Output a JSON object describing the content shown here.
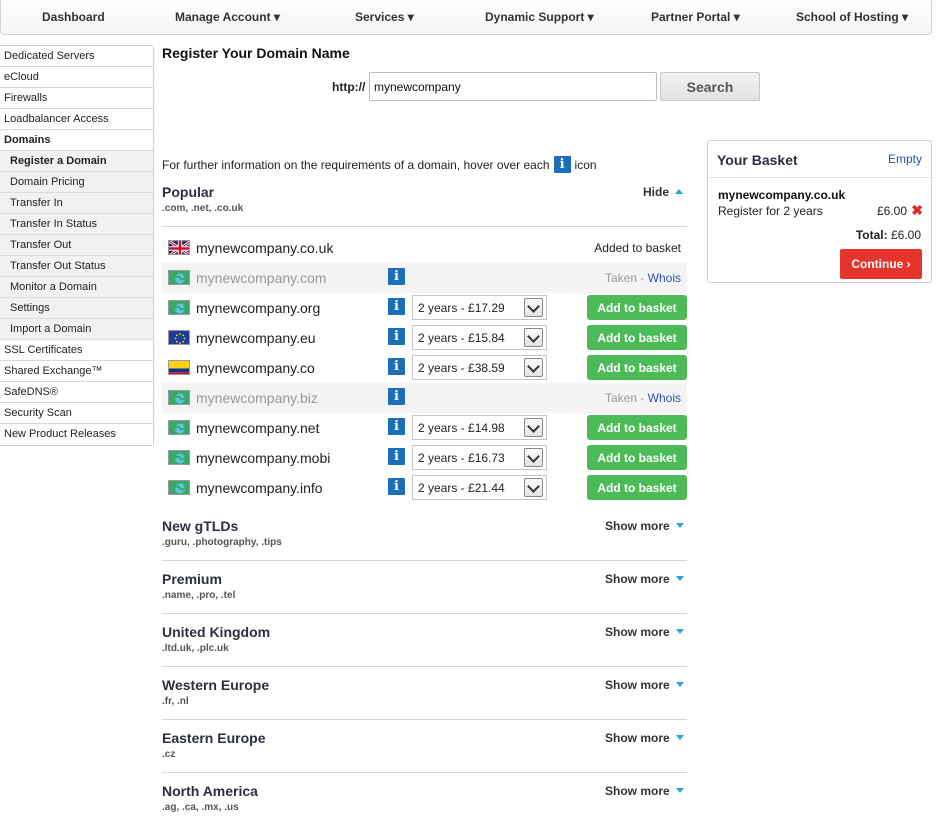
{
  "nav": {
    "items": [
      {
        "label": "Dashboard"
      },
      {
        "label": "Manage Account ▾"
      },
      {
        "label": "Services ▾"
      },
      {
        "label": "Dynamic Support ▾"
      },
      {
        "label": "Partner Portal ▾"
      },
      {
        "label": "School of Hosting ▾"
      }
    ]
  },
  "sidebar": {
    "items": [
      {
        "label": "Dedicated Servers"
      },
      {
        "label": "eCloud"
      },
      {
        "label": "Firewalls"
      },
      {
        "label": "Loadbalancer Access"
      },
      {
        "label": "Domains"
      },
      {
        "label": "Register a Domain"
      },
      {
        "label": "Domain Pricing"
      },
      {
        "label": "Transfer In"
      },
      {
        "label": "Transfer In Status"
      },
      {
        "label": "Transfer Out"
      },
      {
        "label": "Transfer Out Status"
      },
      {
        "label": "Monitor a Domain"
      },
      {
        "label": "Settings"
      },
      {
        "label": "Import a Domain"
      },
      {
        "label": "SSL Certificates"
      },
      {
        "label": "Shared Exchange™"
      },
      {
        "label": "SafeDNS®"
      },
      {
        "label": "Security Scan"
      },
      {
        "label": "New Product Releases"
      }
    ]
  },
  "main": {
    "title": "Register Your Domain Name",
    "http_label": "http://",
    "search_value": "mynewcompany",
    "search_button": "Search",
    "info_before": "For further information on the requirements of a domain, hover over each",
    "info_after": "icon",
    "info_icon_glyph": "i"
  },
  "popular": {
    "title": "Popular",
    "subtitle": ".com, .net, .co.uk",
    "toggle": "Hide",
    "rows": [
      {
        "domain": "mynewcompany.co.uk",
        "flag": "uk",
        "status": "Added to basket"
      },
      {
        "domain": "mynewcompany.com",
        "flag": "generic",
        "status": "Taken - ",
        "whois": "Whois"
      },
      {
        "domain": "mynewcompany.org",
        "flag": "generic",
        "price": "2 years - £17.29",
        "button": "Add to basket"
      },
      {
        "domain": "mynewcompany.eu",
        "flag": "eu",
        "price": "2 years - £15.84",
        "button": "Add to basket"
      },
      {
        "domain": "mynewcompany.co",
        "flag": "co",
        "price": "2 years - £38.59",
        "button": "Add to basket"
      },
      {
        "domain": "mynewcompany.biz",
        "flag": "generic",
        "status": "Taken - ",
        "whois": "Whois"
      },
      {
        "domain": "mynewcompany.net",
        "flag": "generic",
        "price": "2 years - £14.98",
        "button": "Add to basket"
      },
      {
        "domain": "mynewcompany.mobi",
        "flag": "generic",
        "price": "2 years - £16.73",
        "button": "Add to basket"
      },
      {
        "domain": "mynewcompany.info",
        "flag": "generic",
        "price": "2 years - £21.44",
        "button": "Add to basket"
      }
    ]
  },
  "sections": [
    {
      "title": "New gTLDs",
      "subtitle": ".guru, .photography, .tips",
      "toggle": "Show more"
    },
    {
      "title": "Premium",
      "subtitle": ".name, .pro, .tel",
      "toggle": "Show more"
    },
    {
      "title": "United Kingdom",
      "subtitle": ".ltd.uk, .plc.uk",
      "toggle": "Show more"
    },
    {
      "title": "Western Europe",
      "subtitle": ".fr, .nl",
      "toggle": "Show more"
    },
    {
      "title": "Eastern Europe",
      "subtitle": ".cz",
      "toggle": "Show more"
    },
    {
      "title": "North America",
      "subtitle": ".ag, .ca, .mx, .us",
      "toggle": "Show more"
    }
  ],
  "basket": {
    "title": "Your Basket",
    "empty": "Empty",
    "domain": "mynewcompany.co.uk",
    "term": "Register for 2 years",
    "price": "£6.00",
    "remove_glyph": "✖",
    "total_label": "Total:",
    "total_value": "£6.00",
    "continue": "Continue ›"
  },
  "colors": {
    "add_button": "#4cbb57",
    "continue_button": "#e5342b",
    "info_icon": "#1a6fb8",
    "caret": "#2aa5d8",
    "link": "#2b4fa6"
  }
}
